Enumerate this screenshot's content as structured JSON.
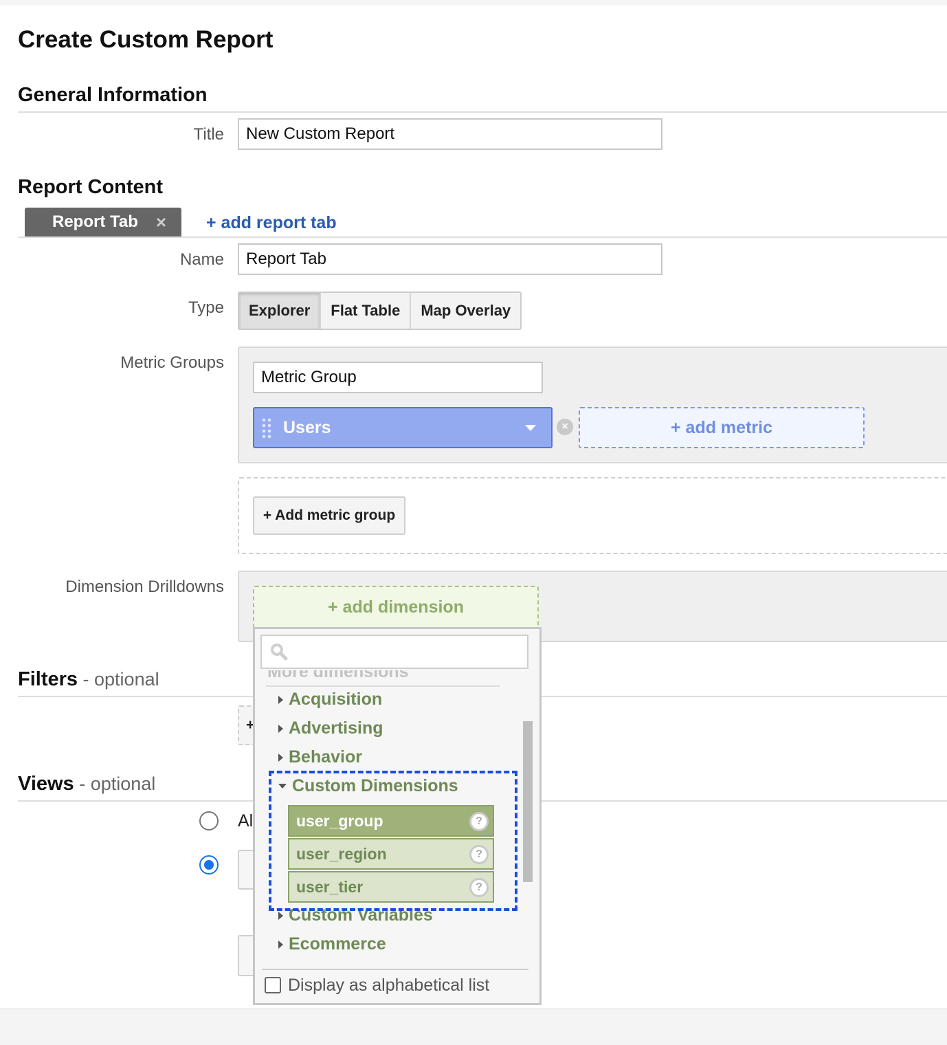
{
  "page_title": "Create Custom Report",
  "general": {
    "heading": "General Information",
    "title_label": "Title",
    "title_value": "New Custom Report"
  },
  "report_content": {
    "heading": "Report Content",
    "tab_label": "Report Tab",
    "tab_close": "×",
    "add_tab": "+ add report tab",
    "name_label": "Name",
    "name_value": "Report Tab",
    "type_label": "Type",
    "types": [
      "Explorer",
      "Flat Table",
      "Map Overlay"
    ],
    "metric_groups_label": "Metric Groups",
    "metric_group_name": "Metric Group",
    "metric": "Users",
    "add_metric": "+ add metric",
    "add_metric_group": "+ Add metric group",
    "dimension_label": "Dimension Drilldowns",
    "add_dimension": "+ add dimension"
  },
  "filters": {
    "heading": "Filters",
    "optional": " - optional",
    "partial_btn": "+"
  },
  "views": {
    "heading": "Views",
    "optional": " - optional",
    "partial_label": "Al"
  },
  "dropdown": {
    "header_partial": "More dimensions",
    "categories": {
      "acquisition": "Acquisition",
      "advertising": "Advertising",
      "behavior": "Behavior",
      "custom_dimensions": "Custom Dimensions",
      "custom_variables": "Custom Variables",
      "ecommerce": "Ecommerce"
    },
    "custom_items": [
      "user_group",
      "user_region",
      "user_tier"
    ],
    "help_glyph": "?",
    "alphabetical": "Display as alphabetical list"
  },
  "colors": {
    "metric_chip": "#94aaf0",
    "dimension_green": "#6e8a55",
    "highlight_border": "#1a4fd8",
    "radio_selected": "#1a73e8"
  }
}
